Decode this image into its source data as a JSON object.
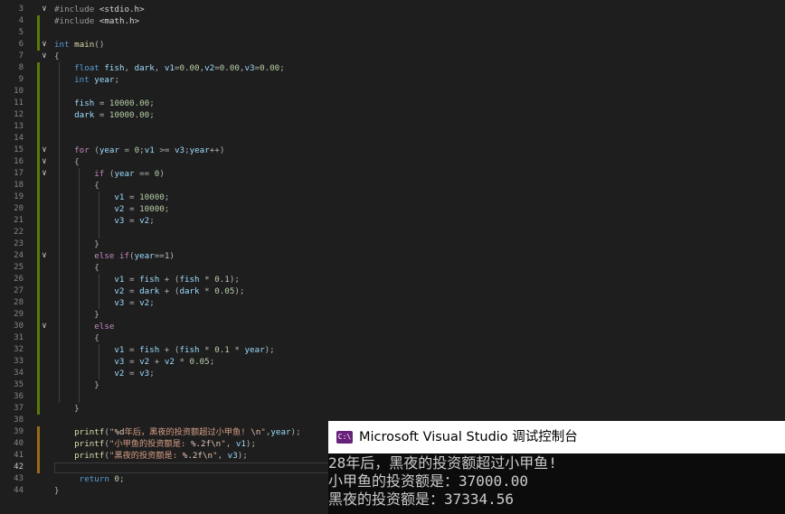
{
  "editor": {
    "lines": [
      {
        "n": "3",
        "c": "#include <stdio.h>"
      },
      {
        "n": "4",
        "c": "#include <math.h>"
      },
      {
        "n": "5",
        "c": ""
      },
      {
        "n": "6",
        "c": "int main()"
      },
      {
        "n": "7",
        "c": "{"
      },
      {
        "n": "8",
        "c": "    float fish, dark, v1=0.00,v2=0.00,v3=0.00;"
      },
      {
        "n": "9",
        "c": "    int year;"
      },
      {
        "n": "10",
        "c": ""
      },
      {
        "n": "11",
        "c": "    fish = 10000.00;"
      },
      {
        "n": "12",
        "c": "    dark = 10000.00;"
      },
      {
        "n": "13",
        "c": ""
      },
      {
        "n": "14",
        "c": ""
      },
      {
        "n": "15",
        "c": "    for (year = 0;v1 >= v3;year++)"
      },
      {
        "n": "16",
        "c": "    {"
      },
      {
        "n": "17",
        "c": "        if (year == 0)"
      },
      {
        "n": "18",
        "c": "        {"
      },
      {
        "n": "19",
        "c": "            v1 = 10000;"
      },
      {
        "n": "20",
        "c": "            v2 = 10000;"
      },
      {
        "n": "21",
        "c": "            v3 = v2;"
      },
      {
        "n": "22",
        "c": ""
      },
      {
        "n": "23",
        "c": "        }"
      },
      {
        "n": "24",
        "c": "        else if(year==1)"
      },
      {
        "n": "25",
        "c": "        {"
      },
      {
        "n": "26",
        "c": "            v1 = fish + (fish * 0.1);"
      },
      {
        "n": "27",
        "c": "            v2 = dark + (dark * 0.05);"
      },
      {
        "n": "28",
        "c": "            v3 = v2;"
      },
      {
        "n": "29",
        "c": "        }"
      },
      {
        "n": "30",
        "c": "        else"
      },
      {
        "n": "31",
        "c": "        {"
      },
      {
        "n": "32",
        "c": "            v1 = fish + (fish * 0.1 * year);"
      },
      {
        "n": "33",
        "c": "            v3 = v2 + v2 * 0.05;"
      },
      {
        "n": "34",
        "c": "            v2 = v3;"
      },
      {
        "n": "35",
        "c": "        }"
      },
      {
        "n": "36",
        "c": ""
      },
      {
        "n": "37",
        "c": "    }"
      },
      {
        "n": "38",
        "c": ""
      },
      {
        "n": "39",
        "c": "    printf(\"%d年后，黑夜的投资额超过小甲鱼! \\n\",year);"
      },
      {
        "n": "40",
        "c": "    printf(\"小甲鱼的投资额是: %.2f\\n\", v1);"
      },
      {
        "n": "41",
        "c": "    printf(\"黑夜的投资额是: %.2f\\n\", v3);"
      },
      {
        "n": "42",
        "c": ""
      },
      {
        "n": "43",
        "c": "     return 0;"
      },
      {
        "n": "44",
        "c": "}"
      }
    ],
    "active_line": "42",
    "colors": {
      "background": "#1e1e1e",
      "keyword": "#569cd6",
      "string": "#d69d85",
      "number": "#b5cea8",
      "function": "#dcdcaa",
      "saved_change_marker": "#587c0c",
      "unsaved_change_marker": "#9c6b1a"
    }
  },
  "console": {
    "icon_label": "C:\\",
    "icon_name": "console-app-icon",
    "title": "Microsoft Visual Studio 调试控制台",
    "output": [
      "28年后，黑夜的投资额超过小甲鱼!",
      "小甲鱼的投资额是：37000.00",
      "黑夜的投资额是：37334.56"
    ]
  }
}
